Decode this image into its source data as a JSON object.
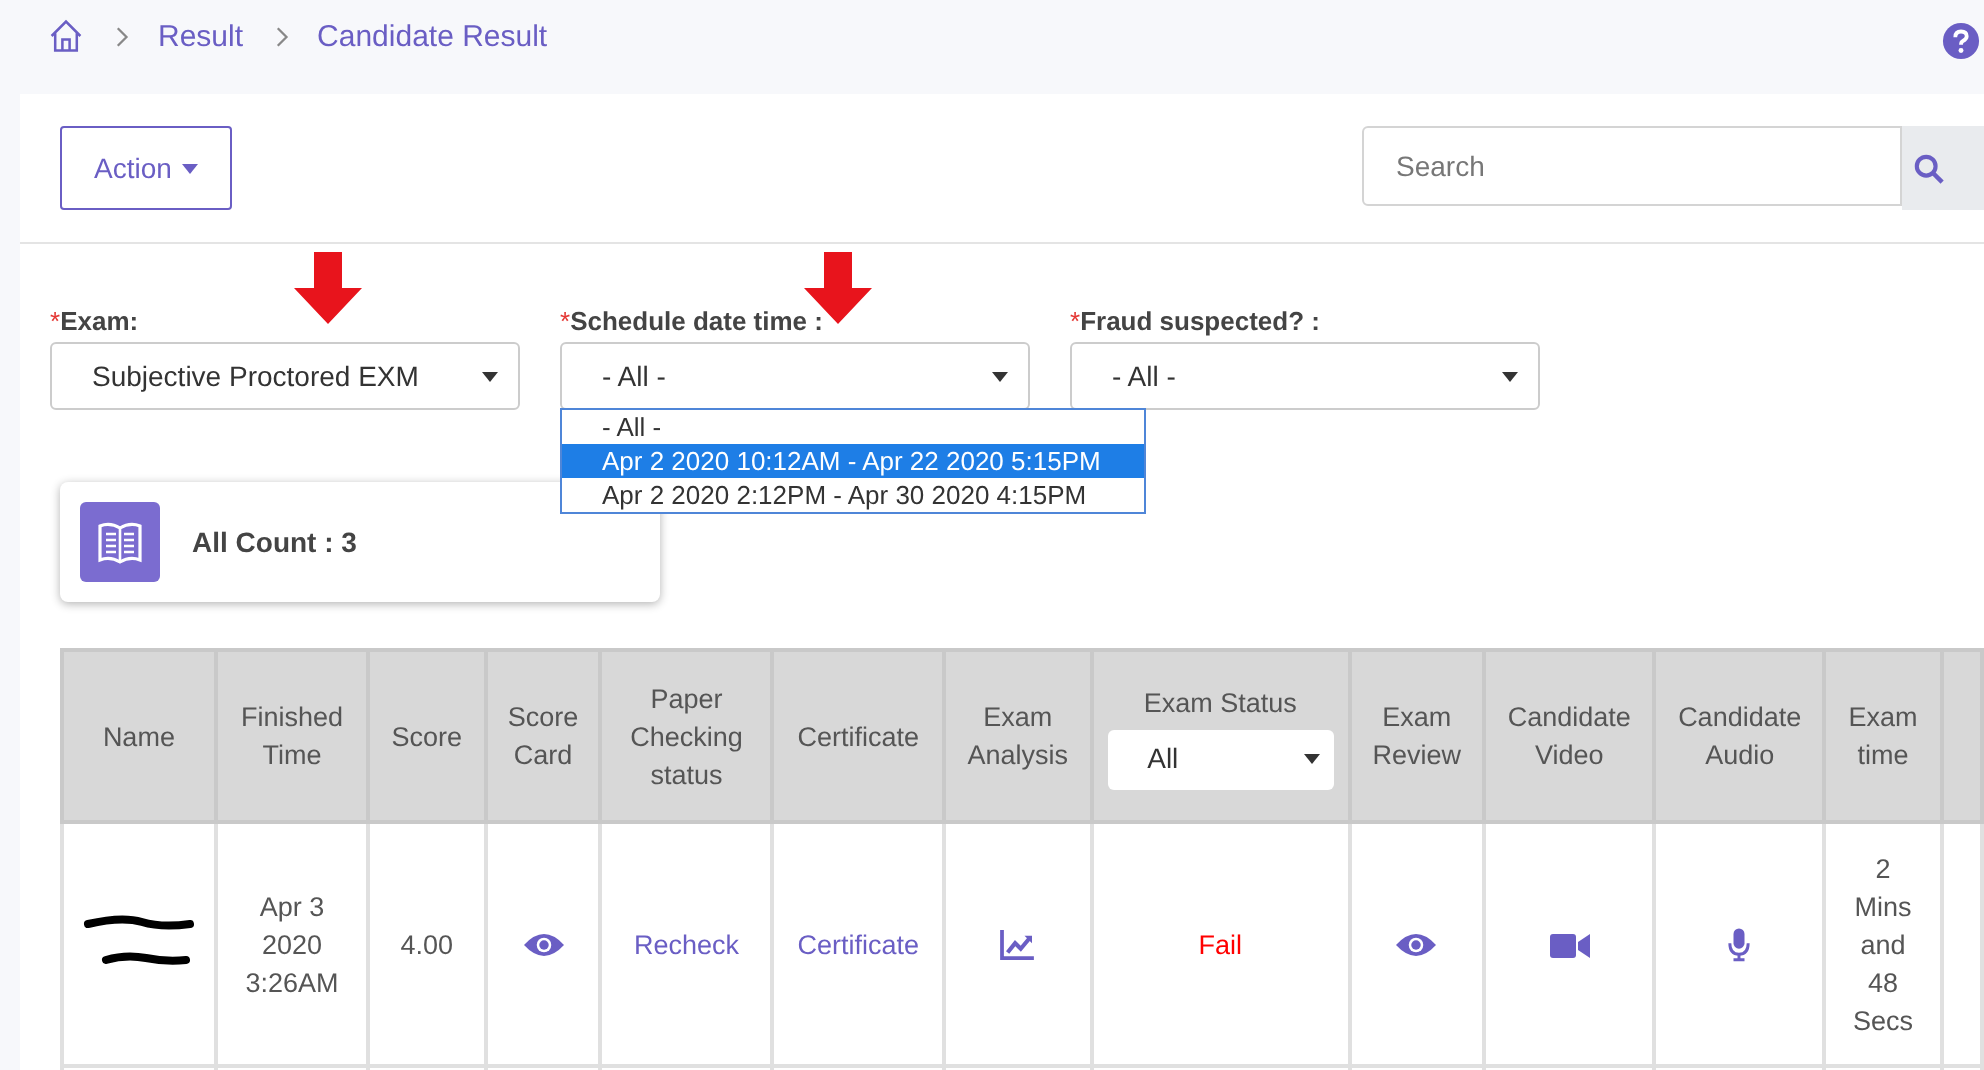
{
  "breadcrumb": [
    {
      "label": "Result"
    },
    {
      "label": "Candidate Result"
    }
  ],
  "toolbar": {
    "action_button": "Action",
    "search": {
      "placeholder": "Search"
    }
  },
  "filters": [
    {
      "label": "Exam:",
      "required_mark": "*",
      "value": "Subjective Proctored EXM",
      "marked": true
    },
    {
      "label": "Schedule date time :",
      "required_mark": "*",
      "value": "- All -",
      "marked": true,
      "open": true,
      "options": [
        {
          "label": "- All -",
          "highlighted": false
        },
        {
          "label": "Apr 2 2020 10:12AM - Apr 22 2020 5:15PM",
          "highlighted": true
        },
        {
          "label": "Apr 2 2020 2:12PM - Apr 30 2020 4:15PM",
          "highlighted": false
        }
      ]
    },
    {
      "label": "Fraud suspected? :",
      "required_mark": "*",
      "value": "- All -",
      "marked": false
    }
  ],
  "count_card": {
    "label": "All Count : 3"
  },
  "table": {
    "columns": [
      {
        "label": "Name"
      },
      {
        "label": "Finished Time"
      },
      {
        "label": "Score"
      },
      {
        "label": "Score Card"
      },
      {
        "label": "Paper Checking status"
      },
      {
        "label": "Certificate"
      },
      {
        "label": "Exam Analysis"
      },
      {
        "label": "Exam Status",
        "filter": "All"
      },
      {
        "label": "Exam Review"
      },
      {
        "label": "Candidate Video"
      },
      {
        "label": "Candidate Audio"
      },
      {
        "label": "Exam time"
      }
    ],
    "rows": [
      {
        "cells": [
          {
            "kind": "redacted"
          },
          {
            "kind": "text",
            "text": "Apr 3 2020 3:26AM"
          },
          {
            "kind": "text",
            "text": "4.00"
          },
          {
            "kind": "icon"
          },
          {
            "kind": "link",
            "text": "Recheck"
          },
          {
            "kind": "link",
            "text": "Certificate"
          },
          {
            "kind": "icon"
          },
          {
            "kind": "status",
            "text": "Fail"
          },
          {
            "kind": "icon"
          },
          {
            "kind": "icon"
          },
          {
            "kind": "icon"
          },
          {
            "kind": "text",
            "text": "2 Mins and 48 Secs"
          }
        ]
      }
    ]
  }
}
